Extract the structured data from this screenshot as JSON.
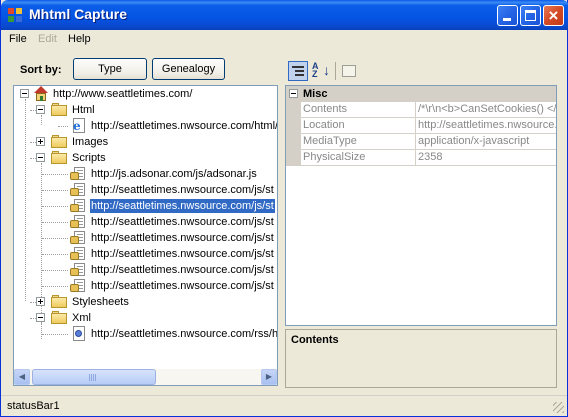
{
  "window": {
    "title": "Mhtml Capture"
  },
  "menu": {
    "file": "File",
    "edit": "Edit",
    "help": "Help"
  },
  "sort": {
    "label": "Sort by:",
    "type_button": "Type",
    "genealogy_button": "Genealogy"
  },
  "tree": {
    "root": "http://www.seattletimes.com/",
    "html_folder": "Html",
    "html_item": "http://seattletimes.nwsource.com/html/",
    "images_folder": "Images",
    "scripts_folder": "Scripts",
    "scripts": [
      "http://js.adsonar.com/js/adsonar.js",
      "http://seattletimes.nwsource.com/js/st",
      "http://seattletimes.nwsource.com/js/st",
      "http://seattletimes.nwsource.com/js/st",
      "http://seattletimes.nwsource.com/js/st",
      "http://seattletimes.nwsource.com/js/st",
      "http://seattletimes.nwsource.com/js/st",
      "http://seattletimes.nwsource.com/js/st"
    ],
    "selected_index": 2,
    "stylesheets_folder": "Stylesheets",
    "xml_folder": "Xml",
    "xml_item": "http://seattletimes.nwsource.com/rss/h"
  },
  "property_grid": {
    "category": "Misc",
    "rows": [
      {
        "name": "Contents",
        "value": "/*\\r\\n<b>CanSetCookies() </b>\\r"
      },
      {
        "name": "Location",
        "value": "http://seattletimes.nwsource.c"
      },
      {
        "name": "MediaType",
        "value": "application/x-javascript"
      },
      {
        "name": "PhysicalSize",
        "value": "2358"
      }
    ],
    "description_title": "Contents"
  },
  "status": {
    "text": "statusBar1"
  },
  "colors": {
    "titlebar": "#0554e3",
    "selection": "#316ac5",
    "window_bg": "#ece9d8"
  }
}
